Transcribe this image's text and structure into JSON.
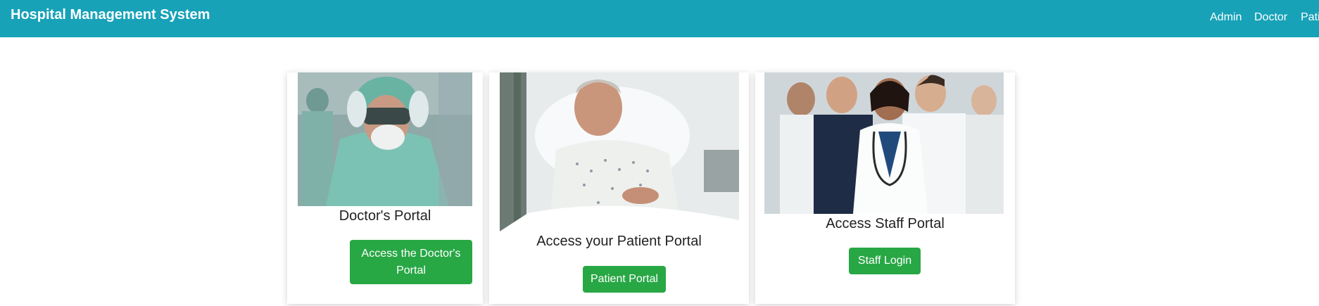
{
  "colors": {
    "navbar": "#17a2b8",
    "button": "#28a745",
    "title_text": "#222222"
  },
  "navbar": {
    "brand": "Hospital Management System",
    "links": [
      {
        "label": "Admin"
      },
      {
        "label": "Doctor"
      },
      {
        "label": "Patient"
      }
    ]
  },
  "cards": [
    {
      "image": "doctor-in-scrubs-and-goggles-photo",
      "title": "Doctor's Portal",
      "button": "Access the Doctor's Portal"
    },
    {
      "image": "smiling-elderly-patient-in-bed-photo",
      "title": "Access your Patient Portal",
      "button": "Patient Portal"
    },
    {
      "image": "group-of-medical-staff-photo",
      "title": "Access Staff Portal",
      "button": "Staff Login"
    }
  ]
}
